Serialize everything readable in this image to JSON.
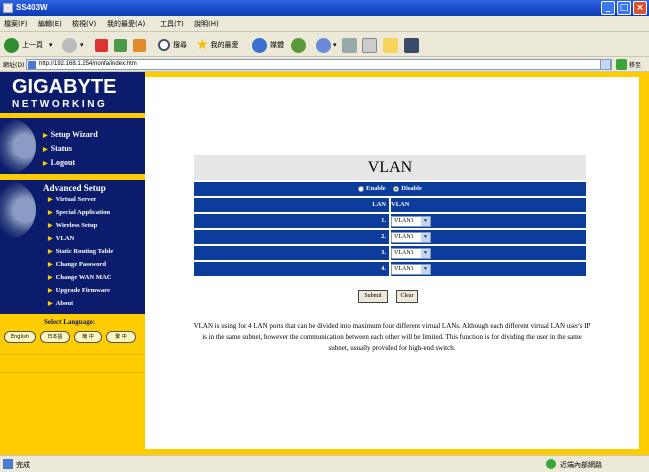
{
  "window": {
    "title": "SS403W"
  },
  "menu": [
    "檔案(F)",
    "編輯(E)",
    "檢視(V)",
    "我的最愛(A)",
    "工具(T)",
    "說明(H)"
  ],
  "toolbar": {
    "back": "上一頁",
    "search": "搜尋",
    "favorites": "我的最愛",
    "media": "媒體"
  },
  "address": {
    "label": "網址(D)",
    "url": "http://192.168.1.254/nonfa/index.htm",
    "go": "移至"
  },
  "brand": {
    "name": "GIGABYTE",
    "sub": "NETWORKING"
  },
  "nav_main": [
    "Setup Wizard",
    "Status",
    "Logout"
  ],
  "advanced": {
    "heading": "Advanced Setup",
    "items": [
      "Virtual Server",
      "Special Application",
      "Wireless Setup",
      "VLAN",
      "Static Routing Table",
      "Change Password",
      "Change WAN MAC",
      "Upgrade Firmware",
      "About"
    ]
  },
  "language": {
    "label": "Select Language:",
    "buttons": [
      "English",
      "日本語",
      "簡 中",
      "繁 中"
    ]
  },
  "vlan": {
    "title": "VLAN",
    "enable_label": "Enable",
    "disable_label": "Disable",
    "col_lan": "LAN",
    "col_vlan": "VLAN",
    "rows": [
      {
        "lan": "1.",
        "vlan": "VLAN1"
      },
      {
        "lan": "2.",
        "vlan": "VLAN1"
      },
      {
        "lan": "3.",
        "vlan": "VLAN1"
      },
      {
        "lan": "4.",
        "vlan": "VLAN1"
      }
    ],
    "submit": "Submit",
    "clear": "Clear",
    "description": "VLAN is using for 4 LAN ports that can be divided into maximum four different virtual LANs. Although each different virtual LAN user's IP is in the same subnet, however the communication between each other will be limited. This function is for dividing the user in the same subnet, usually provided for high-end switch."
  },
  "status": {
    "left": "完成",
    "right": "近端內部網路"
  },
  "colors": {
    "navy": "#0c1c6c",
    "yellow": "#ffcc00",
    "table_blue": "#0c3c9c"
  }
}
